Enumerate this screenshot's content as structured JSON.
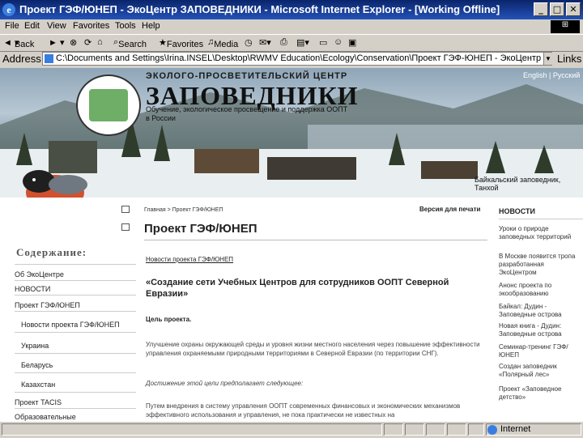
{
  "window": {
    "title": "Проект ГЭФ/ЮНЕП - ЭкоЦентр ЗАПОВЕДНИКИ - Microsoft Internet Explorer - [Working Offline]"
  },
  "menu": [
    "File",
    "Edit",
    "View",
    "Favorites",
    "Tools",
    "Help"
  ],
  "toolbar": {
    "back": "Back",
    "search": "Search",
    "favorites": "Favorites",
    "media": "Media"
  },
  "address": {
    "label": "Address",
    "value": "C:\\Documents and Settings\\Irina.INSEL\\Desktop\\RWMV Education\\Ecology\\Conservation\\Проект ГЭФ-ЮНЕП - ЭкоЦентр ЗАПОВЕДНИКИ",
    "links": "Links"
  },
  "banner": {
    "line1": "ЭКОЛОГО-ПРОСВЕТИТЕЛЬСКИЙ ЦЕНТР",
    "line2": "ЗАПОВЕДНИКИ",
    "line3": "Обучение, экологическое просвещение и поддержка ООПТ в России",
    "lang": "English | Русский",
    "caption": "Байкальский заповедник, Танхой"
  },
  "sidebar": {
    "heading": "Содержание:",
    "items": [
      {
        "label": "Об ЭкоЦентре"
      },
      {
        "label": "НОВОСТИ"
      },
      {
        "label": "Проект ГЭФ/ЮНЕП"
      },
      {
        "label": "Новости проекта ГЭФ/ЮНЕП"
      },
      {
        "label": "Украина"
      },
      {
        "label": "Беларусь"
      },
      {
        "label": "Казахстан"
      },
      {
        "label": "Проект TACIS"
      },
      {
        "label": "Образовательные"
      }
    ]
  },
  "main": {
    "breadcrumb": "Главная > Проект ГЭФ/ЮНЕП",
    "print_label": "Версия для печати",
    "page_title": "Проект ГЭФ/ЮНЕП",
    "news_link": "Новости проекта ГЭФ/ЮНЕП",
    "headline": "«Создание сети Учебных Центров для сотрудников ООПТ Северной Евразии»",
    "goal_heading": "Цель проекта.",
    "paragraph1": "Улучшение охраны окружающей среды и уровня жизни местного населения через повышение эффективности управления охраняемыми природными территориями в Северной Евразии (по территории СНГ).",
    "paragraph2": "Достижение этой цели предполагает следующее:",
    "paragraph3": "Путем внедрения в систему управления ООПТ современных финансовых и экономических механизмов эффективного использования и управления, не пока практически не известных на"
  },
  "news": {
    "heading": "НОВОСТИ",
    "items": [
      "Уроки о природе заповедных территорий",
      "В Москве появится тропа разработанная ЭкоЦентром",
      "Анонс проекта по экообразованию",
      "Байкал: Дудин - Заповедные острова",
      "Новая книга - Дудин: Заповедные острова",
      "Семинар-тренинг ГЭФ/ЮНЕП",
      "Создан заповедник «Полярный лес»",
      "Проект «Заповедное детство»"
    ]
  },
  "statusbar": {
    "zone": "Internet"
  }
}
